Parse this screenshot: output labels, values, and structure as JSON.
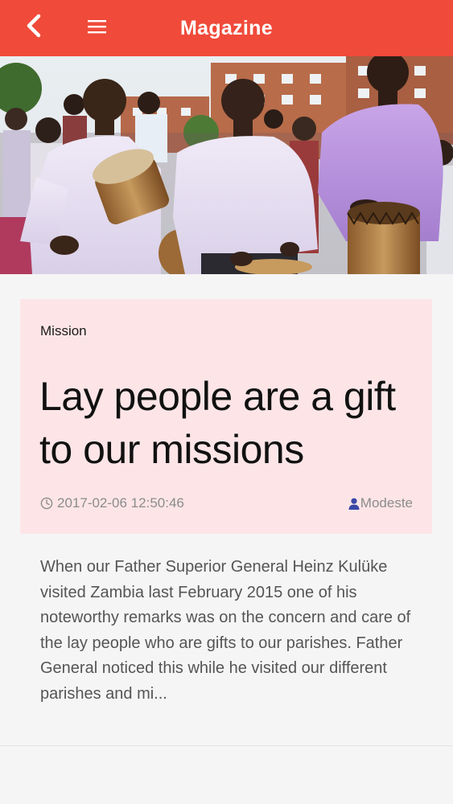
{
  "appbar": {
    "title": "Magazine",
    "back_icon": "chevron-left-icon",
    "menu_icon": "hamburger-menu-icon",
    "color": "#f04a3a"
  },
  "article": {
    "category": "Mission",
    "headline": "Lay people are a gift to our missions",
    "date": "2017-02-06 12:50:46",
    "author": "Modeste",
    "excerpt": "When our Father Superior General Heinz Kulüke visited Zambia last February 2015 one of his noteworthy remarks was on the concern and care of the lay people who are gifts to our parishes. Father General noticed this while he visited our different parishes and mi...",
    "card_color": "#fde5e7"
  }
}
